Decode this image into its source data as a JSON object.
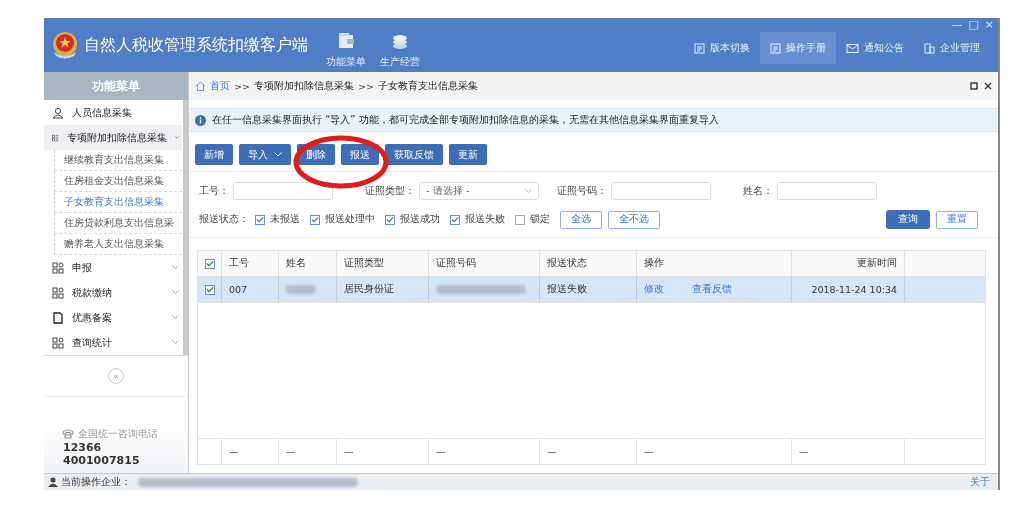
{
  "window": {
    "title": "自然人税收管理系统扣缴客户端",
    "controls": [
      "—",
      "□",
      "×"
    ]
  },
  "nav": [
    {
      "label": "功能菜单"
    },
    {
      "label": "生产经营"
    }
  ],
  "links": [
    {
      "label": "版本切换",
      "selected": false
    },
    {
      "label": "操作手册",
      "selected": true
    },
    {
      "label": "通知公告",
      "selected": false
    },
    {
      "label": "企业管理",
      "selected": false
    }
  ],
  "sidebar": {
    "title": "功能菜单",
    "items": [
      {
        "label": "人员信息采集"
      },
      {
        "label": "专项附加扣除信息采集",
        "expanded": true,
        "children": [
          {
            "label": "继续教育支出信息采集",
            "selected": false
          },
          {
            "label": "住房租金支出信息采集",
            "selected": false
          },
          {
            "label": "子女教育支出信息采集",
            "selected": true
          },
          {
            "label": "住房贷款利息支出信息采",
            "selected": false
          },
          {
            "label": "赡养老人支出信息采集",
            "selected": false
          }
        ]
      },
      {
        "label": "申报",
        "expanded": false
      },
      {
        "label": "税款缴纳",
        "expanded": false
      },
      {
        "label": "优惠备案",
        "expanded": false
      },
      {
        "label": "查询统计",
        "expanded": false
      }
    ],
    "collapse": "«",
    "hotline": {
      "label": "全国统一咨询电话",
      "numbers": [
        "12366",
        "4001007815"
      ]
    }
  },
  "breadcrumb": {
    "items": [
      "首页",
      "专项附加扣除信息采集",
      "子女教育支出信息采集"
    ],
    "separator": ">>"
  },
  "notice": "在任一信息采集界面执行 “导入” 功能，都可完成全部专项附加扣除信息的采集，无需在其他信息采集界面重复导入",
  "toolbar": [
    {
      "label": "新增",
      "dropdown": false
    },
    {
      "label": "导入",
      "dropdown": true
    },
    {
      "label": "删除",
      "dropdown": false
    },
    {
      "label": "报送",
      "dropdown": false
    },
    {
      "label": "获取反馈",
      "dropdown": false
    },
    {
      "label": "更新",
      "dropdown": false
    }
  ],
  "filters": [
    {
      "label": "工号：",
      "kind": "input"
    },
    {
      "label": "证照类型：",
      "kind": "select",
      "placeholder": "- 请选择 -"
    },
    {
      "label": "证照号码：",
      "kind": "input"
    },
    {
      "label": "姓名：",
      "kind": "input"
    }
  ],
  "status_filter": {
    "label": "报送状态：",
    "options": [
      {
        "label": "未报送",
        "checked": true
      },
      {
        "label": "报送处理中",
        "checked": true
      },
      {
        "label": "报送成功",
        "checked": true
      },
      {
        "label": "报送失败",
        "checked": true
      },
      {
        "label": "锁定",
        "checked": false
      }
    ],
    "buttons": [
      "全选",
      "全不选"
    ]
  },
  "actions": [
    {
      "label": "查询",
      "primary": true
    },
    {
      "label": "重置",
      "primary": false
    }
  ],
  "table": {
    "header_checked": true,
    "columns": [
      "工号",
      "姓名",
      "证照类型",
      "证照号码",
      "报送状态",
      "操作",
      "更新时间"
    ],
    "rows": [
      {
        "checked": true,
        "selected": true,
        "id": "007",
        "doc_type": "居民身份证",
        "status": "报送失败",
        "actions": [
          "修改",
          "查看反馈"
        ],
        "updated": "2018-11-24 10:34"
      }
    ],
    "footer": [
      "—",
      "—",
      "—",
      "—",
      "—",
      "—",
      "—"
    ]
  },
  "status_bar": {
    "label": "当前操作企业：",
    "link": "关于"
  }
}
